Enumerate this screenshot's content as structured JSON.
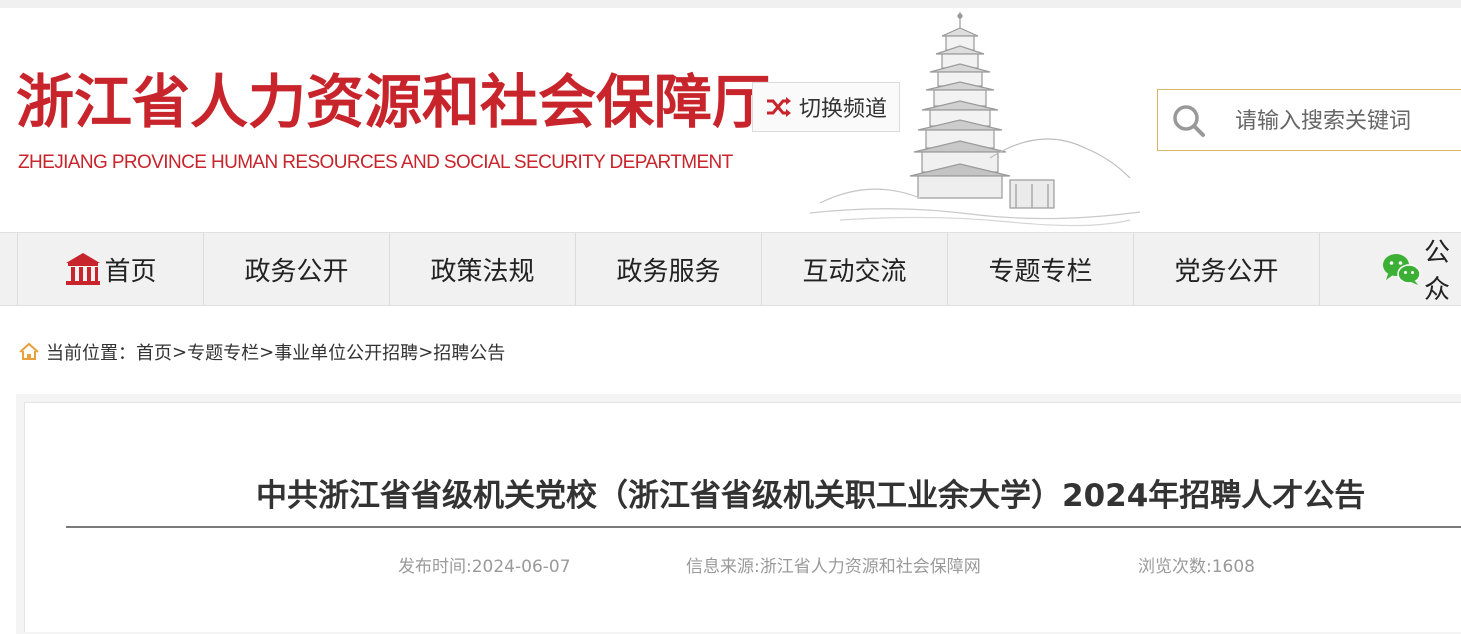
{
  "header": {
    "logo_cn": "浙江省人力资源和社会保障厅",
    "logo_en": "ZHEJIANG PROVINCE HUMAN RESOURCES AND SOCIAL SECURITY DEPARTMENT",
    "switch_label": "切换频道",
    "search_placeholder": "请输入搜索关键词"
  },
  "nav": {
    "items": [
      {
        "label": "首页",
        "icon": "home-building-icon"
      },
      {
        "label": "政务公开"
      },
      {
        "label": "政策法规"
      },
      {
        "label": "政务服务"
      },
      {
        "label": "互动交流"
      },
      {
        "label": "专题专栏"
      },
      {
        "label": "党务公开"
      },
      {
        "label": "公众",
        "icon": "wechat-icon"
      }
    ]
  },
  "breadcrumb": {
    "prefix": "当前位置：",
    "items": [
      "首页",
      "专题专栏",
      "事业单位公开招聘",
      "招聘公告"
    ],
    "separator": ">"
  },
  "article": {
    "title": "中共浙江省省级机关党校（浙江省省级机关职工业余大学）2024年招聘人才公告",
    "publish_time": "发布时间:2024-06-07",
    "source": "信息来源:浙江省人力资源和社会保障网",
    "views": "浏览次数:1608"
  },
  "colors": {
    "brand_red": "#c8242b",
    "search_border": "#d8b36a",
    "wechat_green": "#3cb034",
    "home_orange": "#e8a13a"
  }
}
